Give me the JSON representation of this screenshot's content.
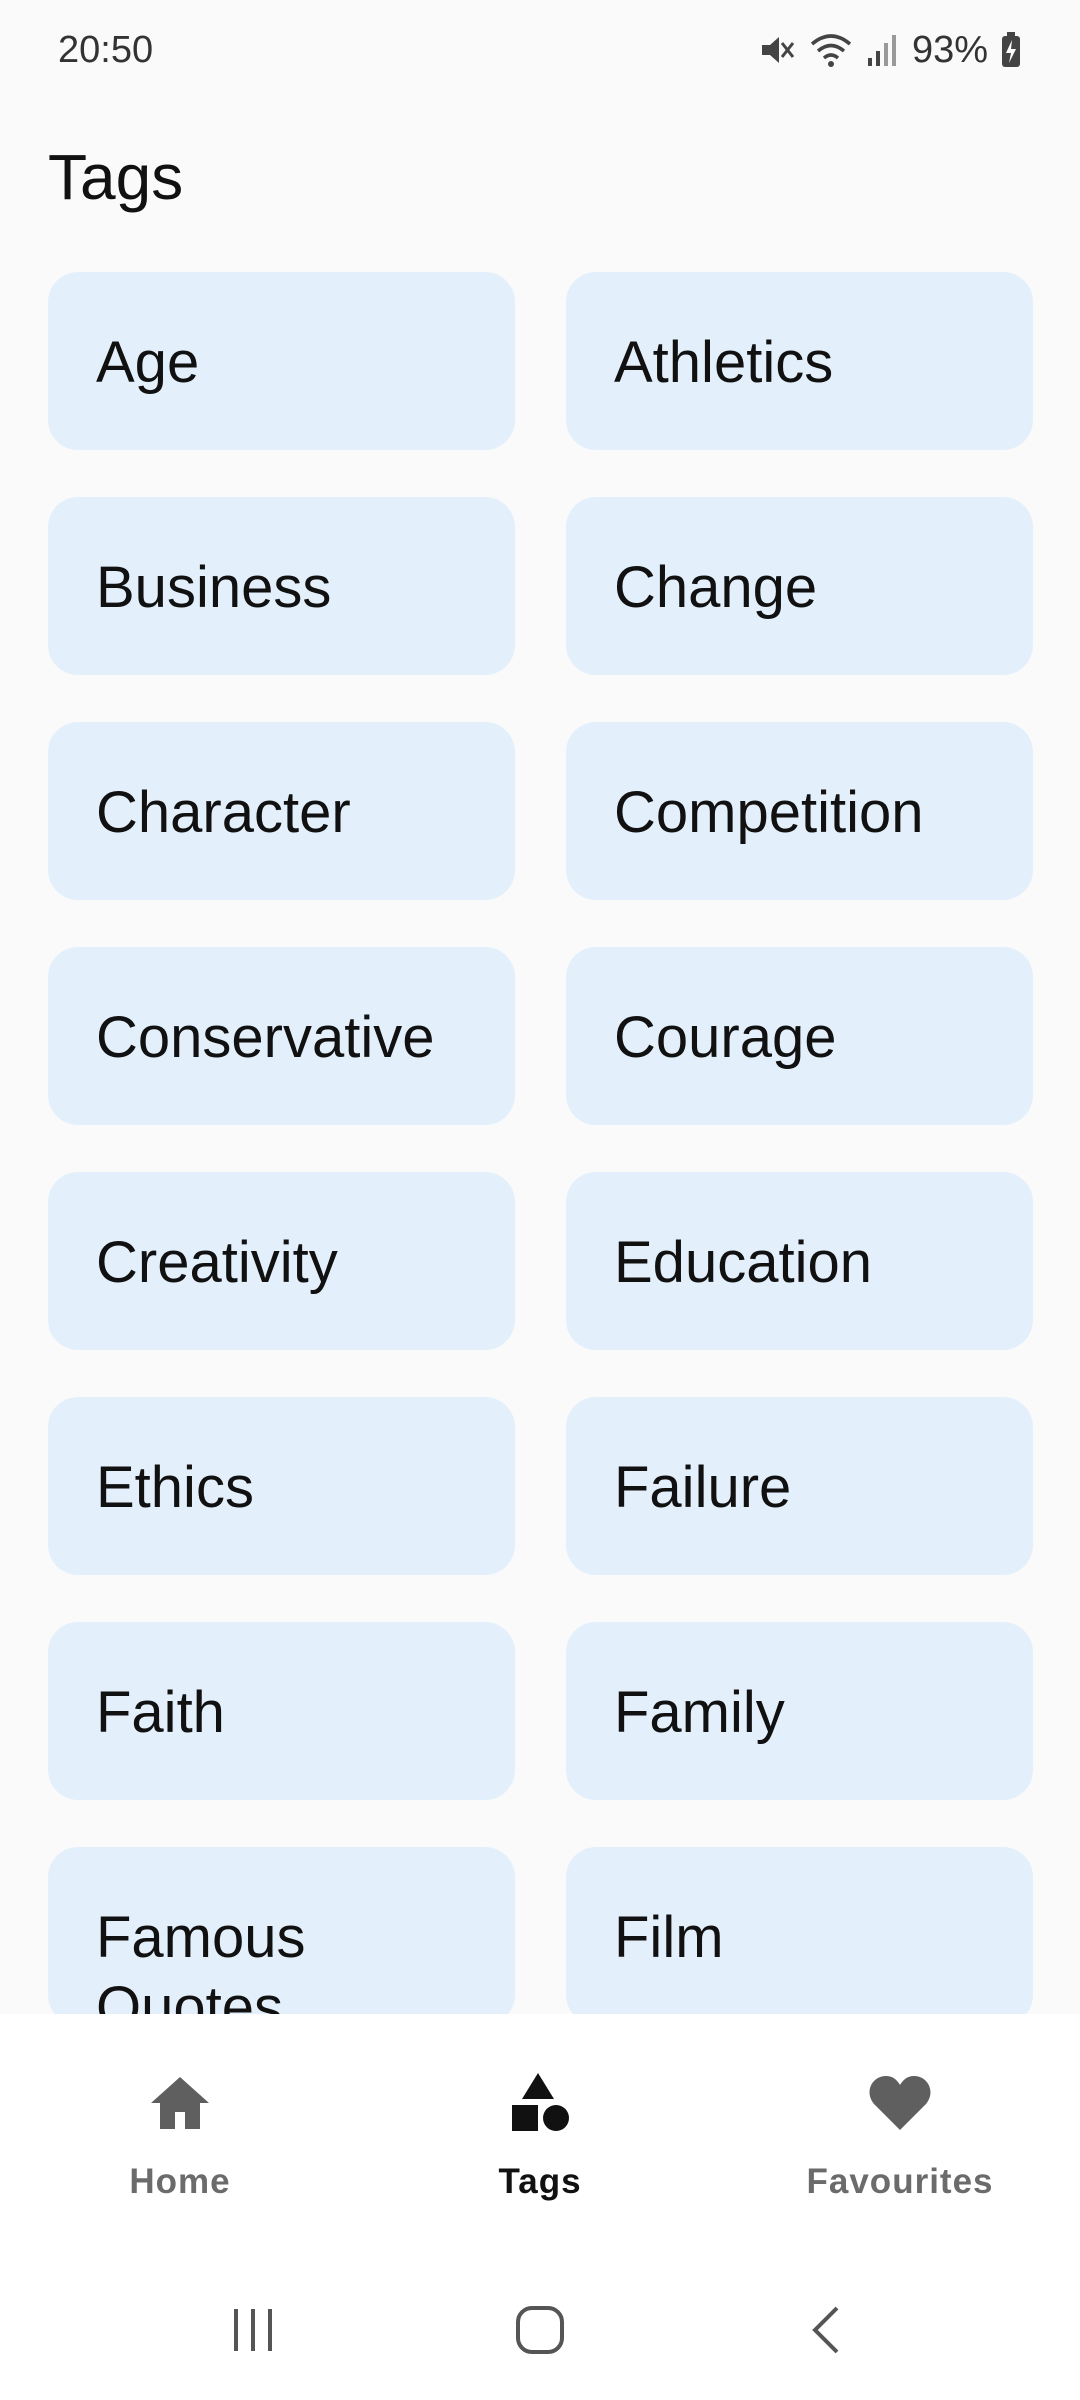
{
  "status_bar": {
    "time": "20:50",
    "battery_percent": "93%",
    "icons": [
      "mute-icon",
      "wifi-icon",
      "signal-icon",
      "battery-charging-icon"
    ]
  },
  "page": {
    "title": "Tags"
  },
  "tags": [
    "Age",
    "Athletics",
    "Business",
    "Change",
    "Character",
    "Competition",
    "Conservative",
    "Courage",
    "Creativity",
    "Education",
    "Ethics",
    "Failure",
    "Faith",
    "Family",
    "Famous Quotes",
    "Film"
  ],
  "bottom_nav": {
    "items": [
      {
        "label": "Home",
        "icon": "home-icon",
        "active": false
      },
      {
        "label": "Tags",
        "icon": "shapes-icon",
        "active": true
      },
      {
        "label": "Favourites",
        "icon": "heart-icon",
        "active": false
      }
    ]
  },
  "system_nav": {
    "buttons": [
      "recent-apps-icon",
      "home-circle-icon",
      "back-icon"
    ]
  },
  "colors": {
    "background": "#fafafa",
    "card": "#e3f0fc",
    "active_nav": "#111111",
    "inactive_nav": "#6b6b6b"
  }
}
